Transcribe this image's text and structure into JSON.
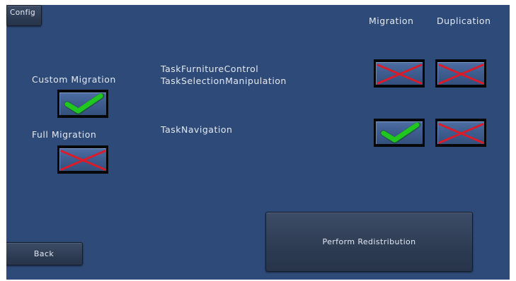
{
  "config_button": "Config",
  "column_headers": {
    "migration": "Migration",
    "duplication": "Duplication"
  },
  "options": {
    "custom_migration": {
      "label": "Custom Migration",
      "checked": true
    },
    "full_migration": {
      "label": "Full Migration",
      "checked": false
    }
  },
  "tasks": [
    {
      "label_lines": [
        "TaskFurnitureControl",
        "TaskSelectionManipulation"
      ],
      "migration": false,
      "duplication": false
    },
    {
      "label_lines": [
        "TaskNavigation"
      ],
      "migration": true,
      "duplication": false
    }
  ],
  "perform_button": "Perform Redistribution",
  "back_button": "Back",
  "colors": {
    "background": "#2e4a78",
    "check_green": "#1fc71f",
    "cross_red": "#dd1a28"
  }
}
